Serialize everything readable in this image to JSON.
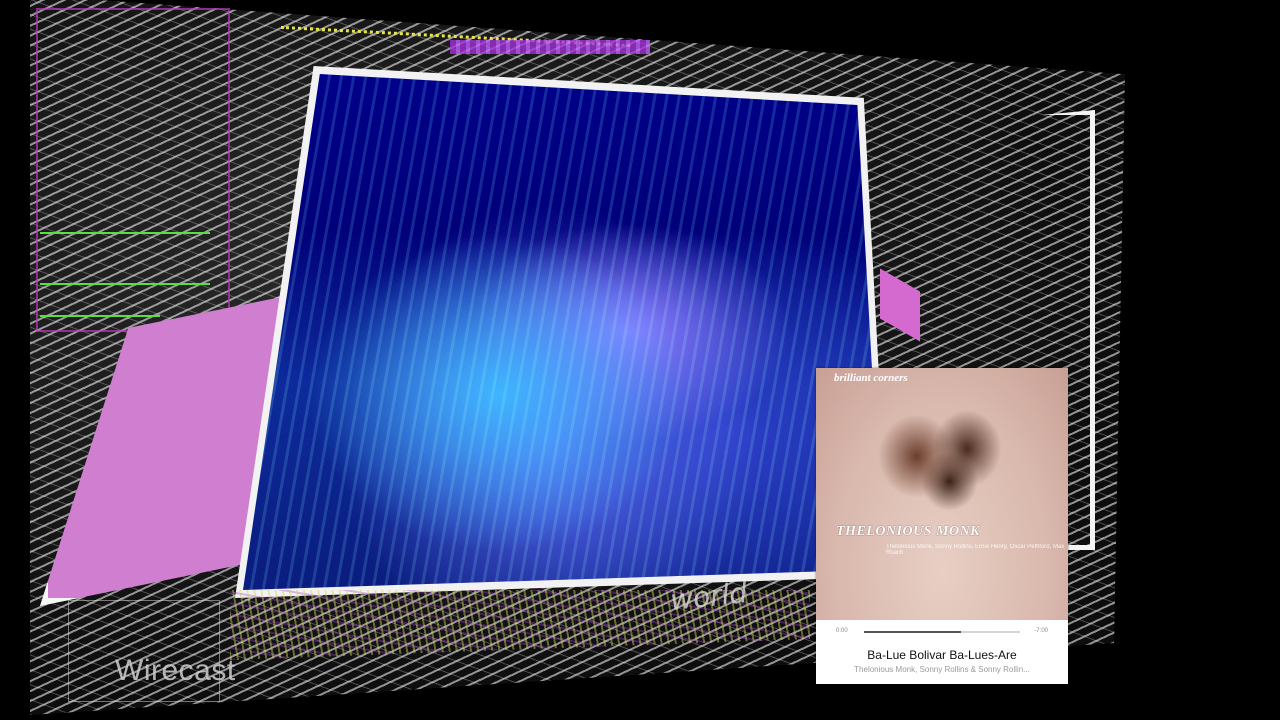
{
  "album": {
    "header": "brilliant corners",
    "artist_title": "THELONIOUS MONK",
    "art_subtitle": "Thelonious Monk, Sonny Rollins, Ernie Henry, Oscar Pettiford, Max Roach",
    "time_elapsed": "0:00",
    "time_remaining": "-7:00",
    "progress": 0.62
  },
  "now_playing": {
    "title": "Ba-Lue Bolivar Ba-Lues-Are",
    "artists": "Thelonious Monk, Sonny Rollins & Sonny Rollin..."
  },
  "watermark": "Wirecast",
  "overlay_text": "world",
  "colors": {
    "video_blue": "#00007a",
    "panel_pink": "#cf7ed0",
    "accent_green": "#58e040",
    "accent_purple": "#a22fd8"
  }
}
